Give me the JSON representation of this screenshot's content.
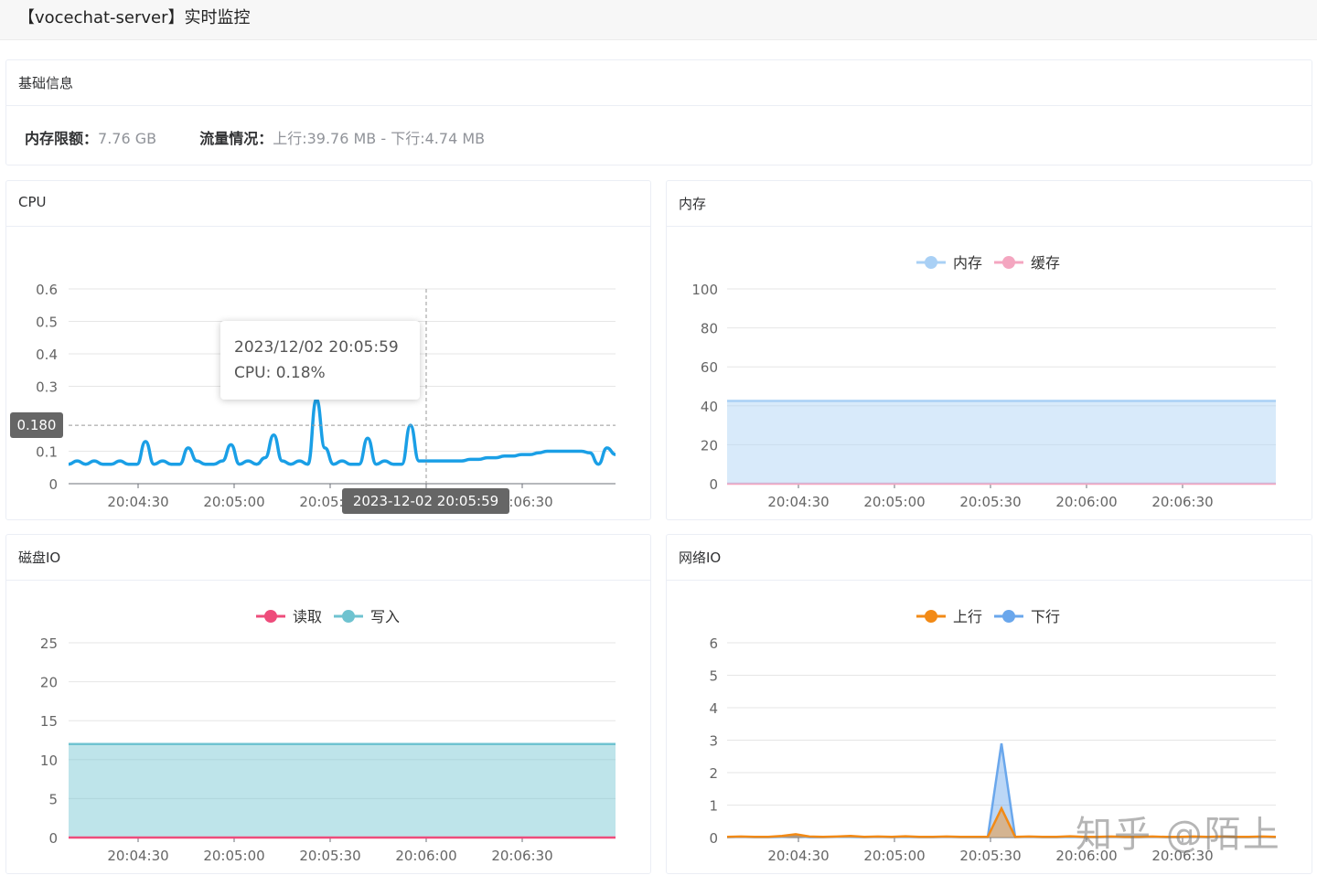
{
  "header": {
    "title": "【vocechat-server】实时监控"
  },
  "basic_info": {
    "title": "基础信息",
    "memory_label": "内存限额：",
    "memory_value": "7.76 GB",
    "traffic_label": "流量情况：",
    "traffic_value": "上行:39.76 MB - 下行:4.74 MB"
  },
  "chart_data": [
    {
      "panel": "CPU",
      "type": "line",
      "title": "CPU",
      "x": [
        "20:04:30",
        "20:05:00",
        "20:05:30",
        "20:06:00",
        "20:06:30"
      ],
      "ylim": [
        0,
        0.6
      ],
      "yticks": [
        "0",
        "0.1",
        "0.3",
        "0.4",
        "0.5",
        "0.6"
      ],
      "series": [
        {
          "values": [
            0.06,
            0.07,
            0.06,
            0.07,
            0.06,
            0.06,
            0.07,
            0.06,
            0.06,
            0.13,
            0.06,
            0.07,
            0.06,
            0.06,
            0.11,
            0.07,
            0.06,
            0.06,
            0.07,
            0.12,
            0.06,
            0.07,
            0.06,
            0.08,
            0.15,
            0.07,
            0.06,
            0.07,
            0.06,
            0.26,
            0.11,
            0.06,
            0.07,
            0.06,
            0.06,
            0.14,
            0.06,
            0.07,
            0.06,
            0.06,
            0.18,
            0.07,
            0.07,
            0.07,
            0.07,
            0.07,
            0.07,
            0.075,
            0.075,
            0.08,
            0.08,
            0.085,
            0.085,
            0.09,
            0.09,
            0.095,
            0.1,
            0.1,
            0.1,
            0.1,
            0.1,
            0.095,
            0.06,
            0.11,
            0.09
          ]
        }
      ],
      "grid": true,
      "tooltip": {
        "time": "2023/12/02 20:05:59",
        "text": "CPU: 0.18%"
      },
      "axis_pointer": {
        "y_label": "0.180",
        "x_label": "2023-12-02 20:05:59"
      }
    },
    {
      "panel": "内存",
      "type": "area",
      "title": "内存",
      "x": [
        "20:04:30",
        "20:05:00",
        "20:05:30",
        "20:06:00",
        "20:06:30"
      ],
      "ylim": [
        0,
        100
      ],
      "yticks": [
        "0",
        "20",
        "40",
        "60",
        "80",
        "100"
      ],
      "series": [
        {
          "name": "内存",
          "values": [
            42.5,
            42.5,
            42.5,
            42.5,
            42.5,
            42.5
          ],
          "color": "#a9d0f5"
        },
        {
          "name": "缓存",
          "values": [
            0,
            0,
            0,
            0,
            0,
            0
          ],
          "color": "#f4a6c0"
        }
      ],
      "legend": "top-center",
      "grid": true
    },
    {
      "panel": "磁盘IO",
      "type": "area",
      "title": "磁盘IO",
      "x": [
        "20:04:30",
        "20:05:00",
        "20:05:30",
        "20:06:00",
        "20:06:30"
      ],
      "ylim": [
        0,
        25
      ],
      "yticks": [
        "0",
        "5",
        "10",
        "15",
        "20",
        "25"
      ],
      "series": [
        {
          "name": "读取",
          "values": [
            0,
            0,
            0,
            0,
            0,
            0
          ],
          "color": "#ee4c7b"
        },
        {
          "name": "写入",
          "values": [
            12,
            12,
            12,
            12,
            12,
            12
          ],
          "color": "#6fc3d0"
        }
      ],
      "legend": "top-center",
      "grid": true
    },
    {
      "panel": "网络IO",
      "type": "area",
      "title": "网络IO",
      "x": [
        "20:04:30",
        "20:05:00",
        "20:05:30",
        "20:06:00",
        "20:06:30"
      ],
      "ylim": [
        0,
        6
      ],
      "yticks": [
        "0",
        "1",
        "2",
        "3",
        "4",
        "5",
        "6"
      ],
      "series": [
        {
          "name": "上行",
          "values": [
            0.02,
            0.03,
            0.02,
            0.02,
            0.05,
            0.1,
            0.03,
            0.02,
            0.03,
            0.05,
            0.02,
            0.03,
            0.02,
            0.04,
            0.02,
            0.02,
            0.03,
            0.02,
            0.02,
            0.02,
            0.9,
            0.02,
            0.03,
            0.02,
            0.02,
            0.04,
            0.02,
            0.02,
            0.03,
            0.02,
            0.02,
            0.03,
            0.02,
            0.02,
            0.03,
            0.02,
            0.03,
            0.02,
            0.02,
            0.03,
            0.02
          ],
          "color": "#f28a16"
        },
        {
          "name": "下行",
          "values": [
            0.01,
            0.02,
            0.01,
            0.01,
            0.02,
            0.05,
            0.01,
            0.01,
            0.02,
            0.02,
            0.01,
            0.02,
            0.01,
            0.02,
            0.01,
            0.01,
            0.02,
            0.01,
            0.01,
            0.01,
            2.9,
            0.01,
            0.02,
            0.01,
            0.01,
            0.02,
            0.01,
            0.01,
            0.02,
            0.01,
            0.01,
            0.02,
            0.01,
            0.01,
            0.02,
            0.01,
            0.02,
            0.01,
            0.01,
            0.02,
            0.01
          ],
          "color": "#6aa7ec"
        }
      ],
      "legend": "top-center",
      "grid": true
    }
  ],
  "watermark": "知乎 @陌上"
}
